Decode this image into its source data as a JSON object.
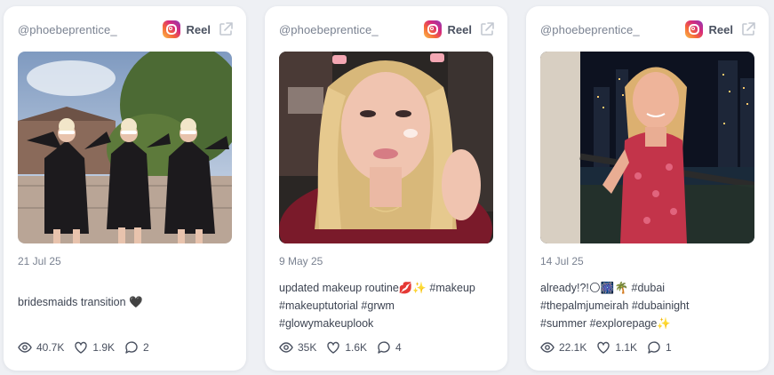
{
  "cards": [
    {
      "handle": "@phoebeprentice_",
      "platform": "Reel",
      "date": "21 Jul 25",
      "caption": [
        "bridesmaids transition 🖤"
      ],
      "views": "40.7K",
      "likes": "1.9K",
      "comments": "2"
    },
    {
      "handle": "@phoebeprentice_",
      "platform": "Reel",
      "date": "9 May 25",
      "caption": [
        "updated makeup routine💋✨ #makeup",
        "#makeuptutorial #grwm",
        "#glowymakeuplook"
      ],
      "views": "35K",
      "likes": "1.6K",
      "comments": "4"
    },
    {
      "handle": "@phoebeprentice_",
      "platform": "Reel",
      "date": "14 Jul 25",
      "caption": [
        "already!?!🌕🎆🌴 #dubai",
        "#thepalmjumeirah #dubainight",
        "#summer #explorepage✨"
      ],
      "views": "22.1K",
      "likes": "1.1K",
      "comments": "1"
    }
  ],
  "colors": {
    "page_bg": "#eef0f4",
    "card_bg": "#ffffff",
    "muted_text": "#7a8291",
    "body_text": "#3d4452"
  },
  "icons": [
    "instagram-icon",
    "external-link-icon",
    "eye-icon",
    "heart-icon",
    "comment-icon"
  ]
}
